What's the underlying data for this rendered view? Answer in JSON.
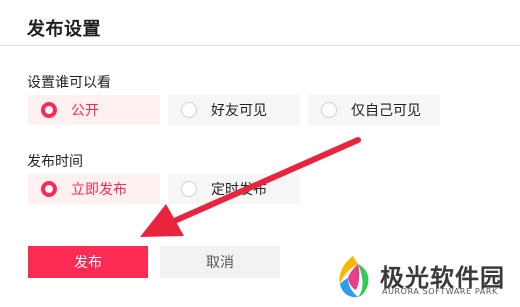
{
  "header": {
    "title": "发布设置"
  },
  "visibility": {
    "label": "设置谁可以看",
    "options": [
      {
        "label": "公开",
        "selected": true
      },
      {
        "label": "好友可见",
        "selected": false
      },
      {
        "label": "仅自己可见",
        "selected": false
      }
    ]
  },
  "publish_time": {
    "label": "发布时间",
    "options": [
      {
        "label": "立即发布",
        "selected": true
      },
      {
        "label": "定时发布",
        "selected": false
      }
    ]
  },
  "actions": {
    "publish_label": "发布",
    "cancel_label": "取消"
  },
  "watermark": {
    "brand_cn": "极光软件园",
    "brand_en": "AURORA SOFTWARE PARK"
  },
  "colors": {
    "accent": "#fe2c55",
    "selected_bg": "#fff0f2",
    "option_bg": "#f6f6f6",
    "annotation_arrow": "#e8253c"
  }
}
